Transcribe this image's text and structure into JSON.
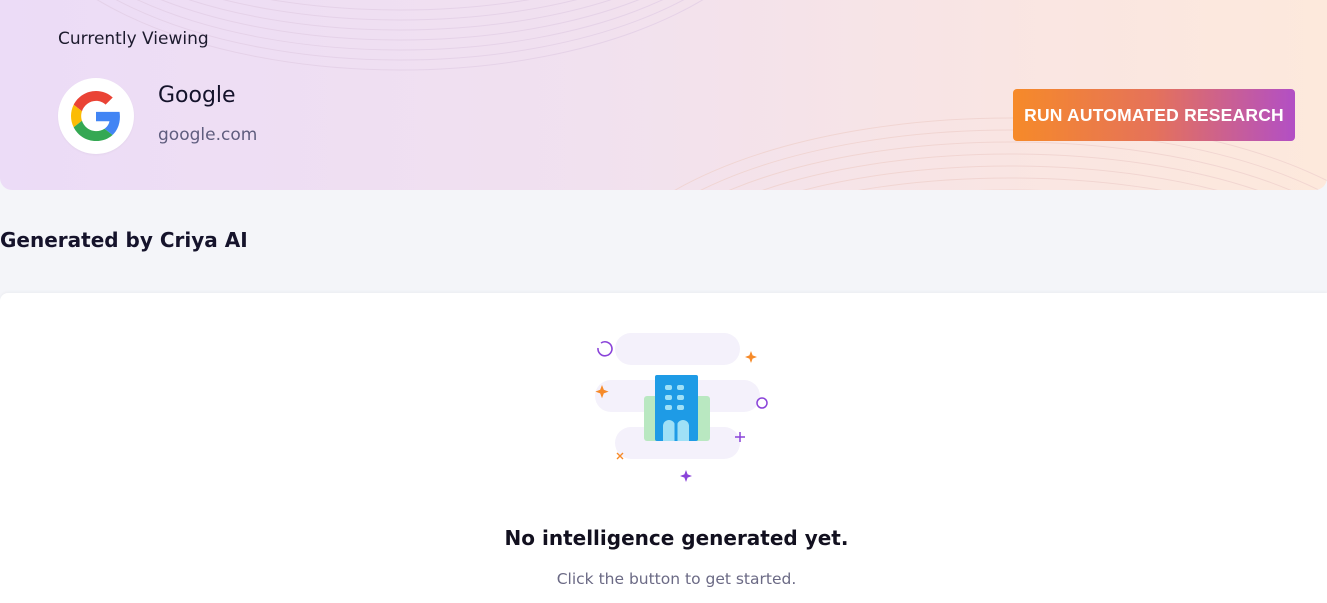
{
  "header": {
    "viewing_label": "Currently Viewing",
    "company": {
      "name": "Google",
      "domain": "google.com",
      "logo_icon": "google-logo-icon"
    },
    "run_button_label": "RUN AUTOMATED RESEARCH"
  },
  "section": {
    "title": "Generated by Criya AI"
  },
  "empty_state": {
    "illustration_icon": "building-icon",
    "title": "No intelligence generated yet.",
    "subtitle": "Click the button to get started."
  },
  "colors": {
    "accent_orange": "#f68a29",
    "accent_purple": "#b24fc5",
    "building_blue": "#1e9be6",
    "building_green": "#b9e8c1"
  }
}
